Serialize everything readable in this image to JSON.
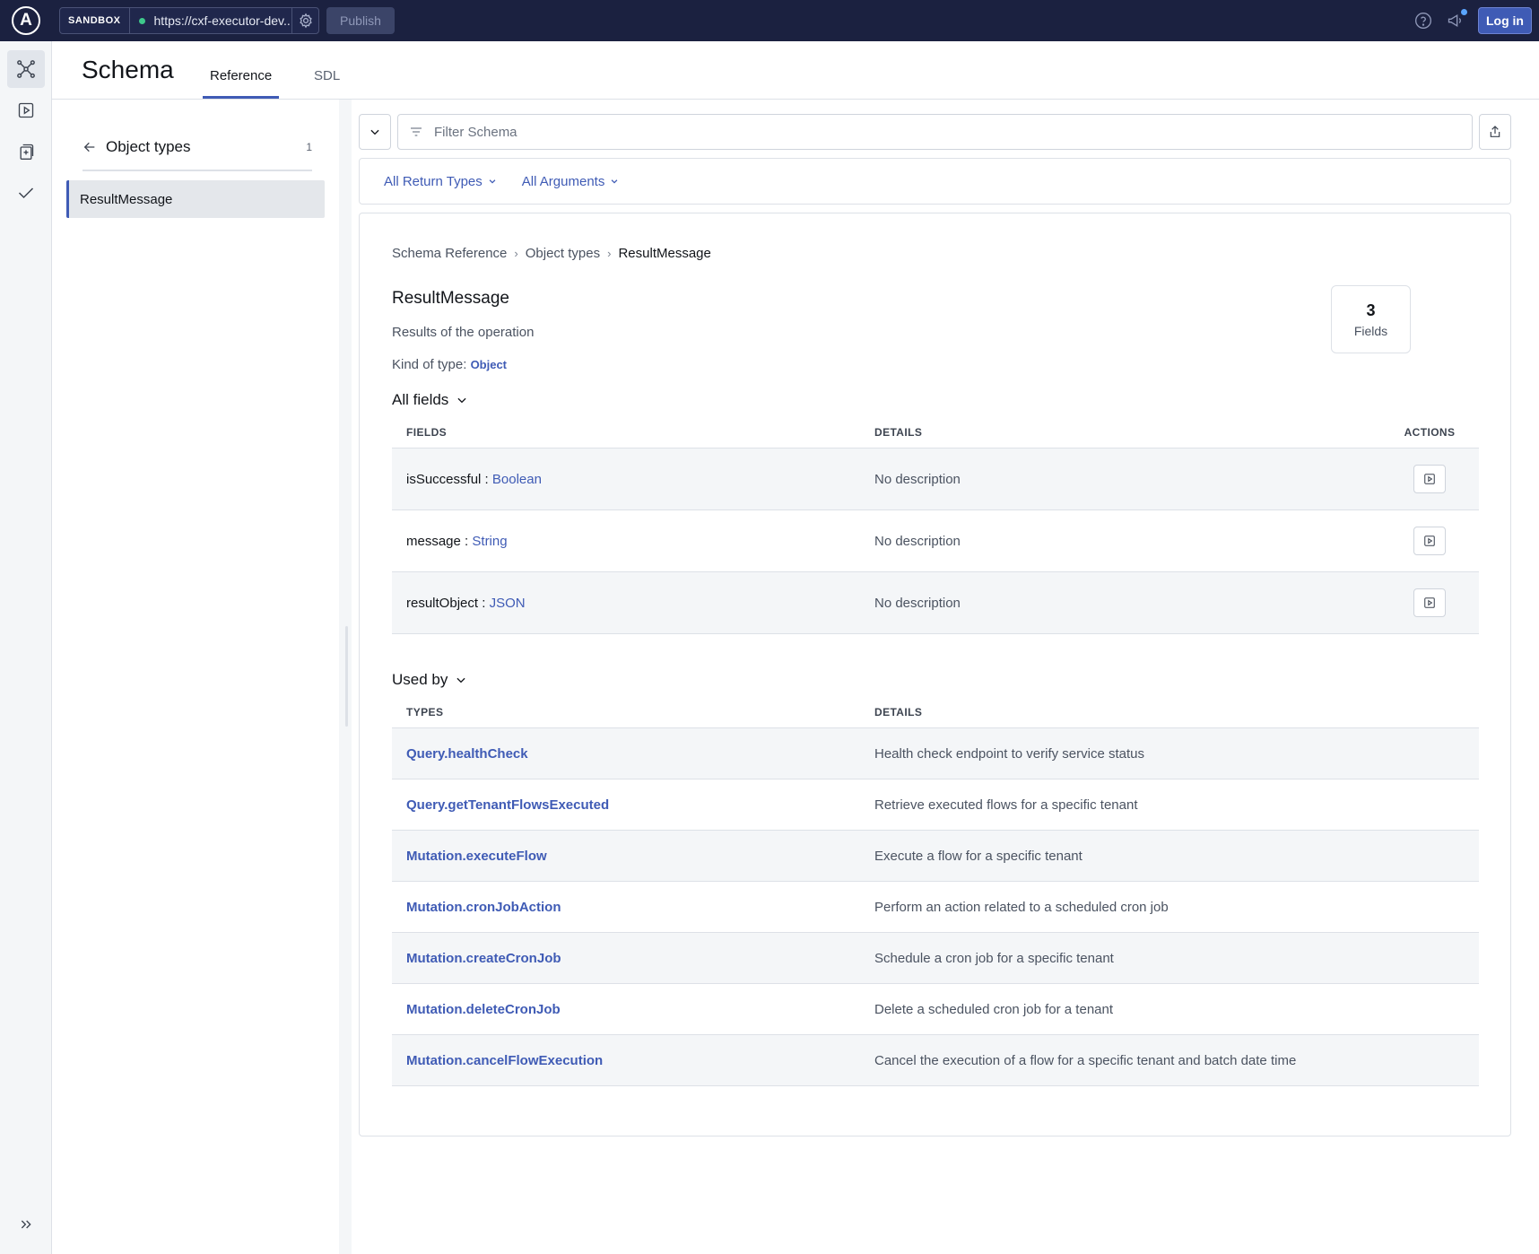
{
  "topbar": {
    "logo_letter": "A",
    "sandbox_label": "SANDBOX",
    "endpoint_url": "https://cxf-executor-dev....",
    "publish_label": "Publish",
    "login_label": "Log in"
  },
  "rail": {
    "items": [
      "schema-icon",
      "play-icon",
      "operations-collection-icon",
      "checks-icon"
    ],
    "expand_icon": "double-chevron-right-icon"
  },
  "header": {
    "title": "Schema",
    "tabs": [
      {
        "label": "Reference",
        "active": true
      },
      {
        "label": "SDL",
        "active": false
      }
    ]
  },
  "sidebar": {
    "back_label": "Object types",
    "count": "1",
    "items": [
      {
        "label": "ResultMessage",
        "selected": true
      }
    ]
  },
  "filter": {
    "placeholder": "Filter Schema",
    "return_types_label": "All Return Types",
    "arguments_label": "All Arguments"
  },
  "detail": {
    "breadcrumb": [
      "Schema Reference",
      "Object types",
      "ResultMessage"
    ],
    "title": "ResultMessage",
    "description": "Results of the operation",
    "kind_label": "Kind of type:",
    "kind_value": "Object",
    "fields_count": "3",
    "fields_count_label": "Fields"
  },
  "all_fields": {
    "heading": "All fields",
    "columns": [
      "FIELDS",
      "DETAILS",
      "ACTIONS"
    ],
    "rows": [
      {
        "name": "isSuccessful",
        "sep": " : ",
        "type": "Boolean",
        "details": "No description"
      },
      {
        "name": "message",
        "sep": " : ",
        "type": "String",
        "details": "No description"
      },
      {
        "name": "resultObject",
        "sep": " : ",
        "type": "JSON",
        "details": "No description"
      }
    ]
  },
  "used_by": {
    "heading": "Used by",
    "columns": [
      "TYPES",
      "DETAILS"
    ],
    "rows": [
      {
        "type": "Query.healthCheck",
        "details": "Health check endpoint to verify service status"
      },
      {
        "type": "Query.getTenantFlowsExecuted",
        "details": "Retrieve executed flows for a specific tenant"
      },
      {
        "type": "Mutation.executeFlow",
        "details": "Execute a flow for a specific tenant"
      },
      {
        "type": "Mutation.cronJobAction",
        "details": "Perform an action related to a scheduled cron job"
      },
      {
        "type": "Mutation.createCronJob",
        "details": "Schedule a cron job for a specific tenant"
      },
      {
        "type": "Mutation.deleteCronJob",
        "details": "Delete a scheduled cron job for a tenant"
      },
      {
        "type": "Mutation.cancelFlowExecution",
        "details": "Cancel the execution of a flow for a specific tenant and batch date time"
      }
    ]
  },
  "colors": {
    "topbar_bg": "#1b2140",
    "accent": "#3f5bb5",
    "status_ok": "#3ec98b"
  }
}
